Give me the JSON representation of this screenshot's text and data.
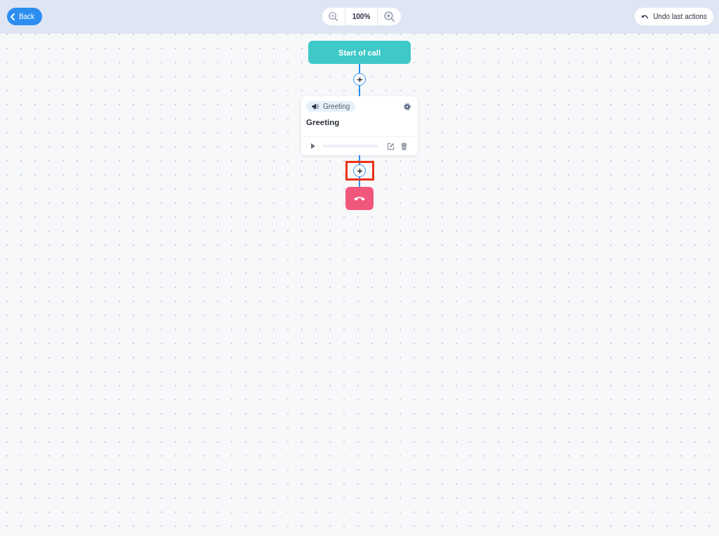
{
  "toolbar": {
    "back_button": {
      "label": "Back"
    },
    "zoom": {
      "value": "100%"
    },
    "undo_button": {
      "label": "Undo last actions"
    }
  },
  "flow": {
    "nodes": [
      {
        "kind": "start",
        "label": "Start of call"
      },
      {
        "kind": "add",
        "highlighted": false
      },
      {
        "kind": "message",
        "tag": "Greeting",
        "title": "Greeting"
      },
      {
        "kind": "add",
        "highlighted": true
      },
      {
        "kind": "end"
      }
    ]
  }
}
